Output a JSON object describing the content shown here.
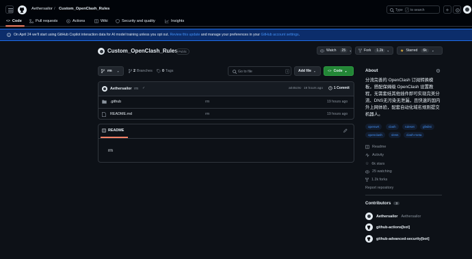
{
  "header": {
    "owner": "Aethersailor",
    "sep": "/",
    "repo": "Custom_OpenClash_Rules",
    "search_text": "Type",
    "search_key": "/",
    "search_suffix": "to search"
  },
  "tabs": [
    {
      "label": "Code"
    },
    {
      "label": "Pull requests"
    },
    {
      "label": "Actions"
    },
    {
      "label": "Wiki"
    },
    {
      "label": "Security and quality"
    },
    {
      "label": "Insights"
    }
  ],
  "banner": {
    "pre": "On April 24 we'll start using GitHub Copilot interaction data for AI model training unless you opt out.",
    "link1": "Review this update",
    "mid": "and manage your preferences in your",
    "link2": "GitHub account settings",
    "post": "."
  },
  "repo": {
    "name": "Custom_OpenClash_Rules",
    "visibility": "Public",
    "watch_label": "Watch",
    "watch_count": "25",
    "fork_label": "Fork",
    "fork_count": "1.2k",
    "star_label": "Starred",
    "star_count": "6k"
  },
  "toolbar": {
    "branch": "rm",
    "branches_count": "2",
    "branches_label": "Branches",
    "tags_count": "0",
    "tags_label": "Tags",
    "goto_placeholder": "Go to file",
    "goto_key": "t",
    "add_file": "Add file",
    "code": "Code"
  },
  "commit": {
    "author": "Aethersailor",
    "message": "rm",
    "hash": "a045c9c",
    "age": "19 hours ago",
    "count_label": "1 Commit"
  },
  "files": [
    {
      "name": ".github",
      "message": "rm",
      "age": "19 hours ago"
    },
    {
      "name": "README.md",
      "message": "rm",
      "age": "19 hours ago"
    }
  ],
  "readme": {
    "title": "README",
    "body": "rm"
  },
  "about": {
    "title": "About",
    "description": "分流完善的 OpenClash 订阅转换模板，搭配保姆级 OpenClash 设置教程，无需套娃其他插件即可实现完美分流、DNS无污染无泄漏，且快速的国内外上网体验，配套自动化域名规则提交机器人。",
    "topics": [
      "openwrt",
      "clash",
      "ruleset",
      "gfwlist",
      "openclash",
      "vless",
      "clash-meta"
    ],
    "links": [
      {
        "icon": "book-icon",
        "label": "Readme"
      },
      {
        "icon": "pulse-icon",
        "label": "Activity"
      },
      {
        "icon": "star-icon",
        "label": "6k stars"
      },
      {
        "icon": "eye-icon",
        "label": "25 watching"
      },
      {
        "icon": "fork-icon",
        "label": "1.2k forks"
      },
      {
        "icon": "",
        "label": "Report repository"
      }
    ]
  },
  "contributors": {
    "title": "Contributors",
    "count": "3",
    "items": [
      {
        "name": "Aethersailor",
        "handle": "Aethersailor"
      },
      {
        "name": "github-actions[bot]",
        "handle": ""
      },
      {
        "name": "github-advanced-security[bot]",
        "handle": ""
      }
    ]
  },
  "colors": {
    "accent": "#238636",
    "link": "#4493f8",
    "banner": "#0c2d6b",
    "tab_underline": "#f78166"
  }
}
